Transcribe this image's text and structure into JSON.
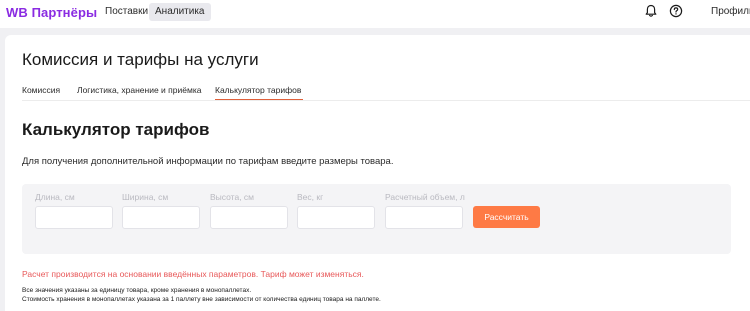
{
  "header": {
    "logo": "WB Партнёры",
    "nav": [
      {
        "label": "Поставки"
      },
      {
        "label": "Аналитика"
      }
    ],
    "icons": [
      "bell-icon",
      "help-icon"
    ],
    "profile_label": "Профиль"
  },
  "page": {
    "title": "Комиссия и тарифы на услуги",
    "tabs": [
      {
        "label": "Комиссия",
        "active": false
      },
      {
        "label": "Логистика, хранение и приёмка",
        "active": false
      },
      {
        "label": "Калькулятор тарифов",
        "active": true
      }
    ]
  },
  "calculator": {
    "title": "Калькулятор тарифов",
    "intro": "Для получения дополнительной информации по тарифам введите размеры товара.",
    "fields": [
      {
        "label": "Длина, см",
        "value": ""
      },
      {
        "label": "Ширина, см",
        "value": ""
      },
      {
        "label": "Высота, см",
        "value": ""
      },
      {
        "label": "Вес, кг",
        "value": ""
      },
      {
        "label": "Расчетный объем, л",
        "value": ""
      }
    ],
    "button_label": "Рассчитать",
    "warning": "Расчет производится на основании введённых параметров. Тариф может изменяться.",
    "notes": [
      "Все значения указаны за единицу товара, кроме хранения в монопаллетах.",
      "Стоимость хранения в монопаллетах указана за 1 паллету вне зависимости от количества единиц товара на паллете."
    ]
  },
  "colors": {
    "brand": "#8a2be2",
    "accent": "#fe7a45",
    "tab_underline": "#e0603a",
    "warning": "#e8595a"
  }
}
